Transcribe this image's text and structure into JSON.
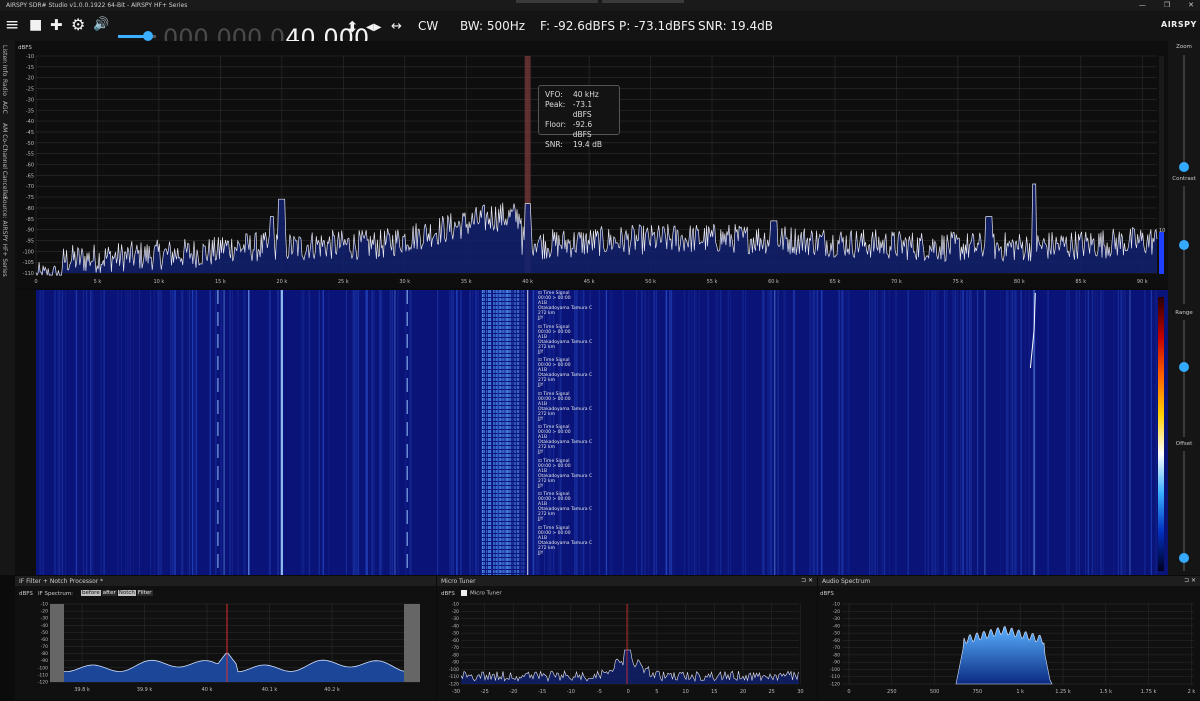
{
  "window": {
    "title": "AIRSPY SDR# Studio v1.0.0.1922 64-Bit - AIRSPY HF+ Series",
    "minimize": "—",
    "restore": "❐",
    "close": "✕"
  },
  "toolbar": {
    "menu_icon": "≡",
    "stop_icon": "■",
    "add_icon": "✚",
    "settings_icon": "⚙",
    "speaker_icon": "🔊",
    "volume": 0.8,
    "frequency_dim": "000.000.0",
    "frequency_lit": "40.000",
    "updown_icon": "⬍",
    "leftright_icon": "◀▶",
    "span_icon": "↔",
    "mode": "CW",
    "bandwidth": "BW: 500Hz",
    "floor": "F: -92.6dBFS",
    "peak": "P: -73.1dBFS",
    "snr": "SNR: 19.4dB",
    "logo": "AIRSPY"
  },
  "left_tabs": [
    "Listen Info",
    "Radio",
    "AGC",
    "AM Co-Channel Canceller",
    "Source: AIRSPY HF+ Series"
  ],
  "right_sliders": {
    "zoom_label": "Zoom",
    "contrast_label": "Contrast",
    "range_label": "Range",
    "offset_label": "Offset",
    "amp_value": "10"
  },
  "spectrum": {
    "unit": "dBFS",
    "y_labels": [
      "-10",
      "-15",
      "-20",
      "-25",
      "-30",
      "-35",
      "-40",
      "-45",
      "-50",
      "-55",
      "-60",
      "-65",
      "-70",
      "-75",
      "-80",
      "-85",
      "-90",
      "-95",
      "-100",
      "-105",
      "-110"
    ],
    "x_labels": [
      "0",
      "5 k",
      "10 k",
      "15 k",
      "20 k",
      "25 k",
      "30 k",
      "35 k",
      "40 k",
      "45 k",
      "50 k",
      "55 k",
      "60 k",
      "65 k",
      "70 k",
      "75 k",
      "80 k",
      "85 k",
      "90 k"
    ],
    "tooltip": [
      {
        "k": "VFO:",
        "v": "40 kHz"
      },
      {
        "k": "Peak:",
        "v": "-73.1 dBFS"
      },
      {
        "k": "Floor:",
        "v": "-92.6 dBFS"
      },
      {
        "k": "SNR:",
        "v": "19.4 dB"
      }
    ]
  },
  "waterfall": {
    "annotations": [
      [
        "Time Signal",
        "00:00 > 00:00",
        "A1B",
        "Otakadoyama Tamura C",
        "272 km",
        "JJY"
      ],
      [
        "Time Signal",
        "00:00 > 00:00",
        "A1B",
        "Otakadoyama Tamura C",
        "272 km",
        "JJY"
      ],
      [
        "Time Signal",
        "00:00 > 00:00",
        "A1B",
        "Otakadoyama Tamura C",
        "272 km",
        "JJY"
      ],
      [
        "Time Signal",
        "00:00 > 00:00",
        "A1B",
        "Otakadoyama Tamura C",
        "272 km",
        "JJY"
      ],
      [
        "Time Signal",
        "00:00 > 00:00",
        "A1B",
        "Otakadoyama Tamura C",
        "272 km",
        "JJY"
      ],
      [
        "Time Signal",
        "00:00 > 00:00",
        "A1B",
        "Otakadoyama Tamura C",
        "272 km",
        "JJY"
      ],
      [
        "Time Signal",
        "00:00 > 00:00",
        "A1B",
        "Otakadoyama Tamura C",
        "272 km",
        "JJY"
      ],
      [
        "Time Signal",
        "00:00 > 00:00",
        "A1B",
        "Otakadoyama Tamura C",
        "272 km",
        "JJY"
      ]
    ]
  },
  "if_panel": {
    "title": "IF Filter + Notch Processor *",
    "unit": "dBFS",
    "spectrum_label": "IF Spectrum:",
    "before": "before",
    "after": "after",
    "notch": "Notch",
    "filter": "Filter",
    "y_labels": [
      "-10",
      "-20",
      "-30",
      "-40",
      "-50",
      "-60",
      "-70",
      "-80",
      "-90",
      "-100",
      "-110",
      "-120"
    ],
    "x_labels": [
      "39.8 k",
      "39.9 k",
      "40 k",
      "40.1 k",
      "40.2 k"
    ]
  },
  "micro_panel": {
    "title": "Micro Tuner",
    "unit": "dBFS",
    "check_label": "Micro Tuner",
    "y_labels": [
      "-10",
      "-20",
      "-30",
      "-40",
      "-50",
      "-60",
      "-70",
      "-80",
      "-90",
      "-100",
      "-110",
      "-120"
    ],
    "x_labels": [
      "-30",
      "-25",
      "-20",
      "-15",
      "-10",
      "-5",
      "0",
      "5",
      "10",
      "15",
      "20",
      "25",
      "30"
    ]
  },
  "audio_panel": {
    "title": "Audio Spectrum",
    "unit": "dBFS",
    "y_labels": [
      "-10",
      "-20",
      "-30",
      "-40",
      "-50",
      "-60",
      "-70",
      "-80",
      "-90",
      "-100",
      "-110",
      "-120"
    ],
    "x_labels": [
      "0",
      "250",
      "500",
      "750",
      "1 k",
      "1.25 k",
      "1.5 k",
      "1.75 k",
      "2 k"
    ]
  }
}
